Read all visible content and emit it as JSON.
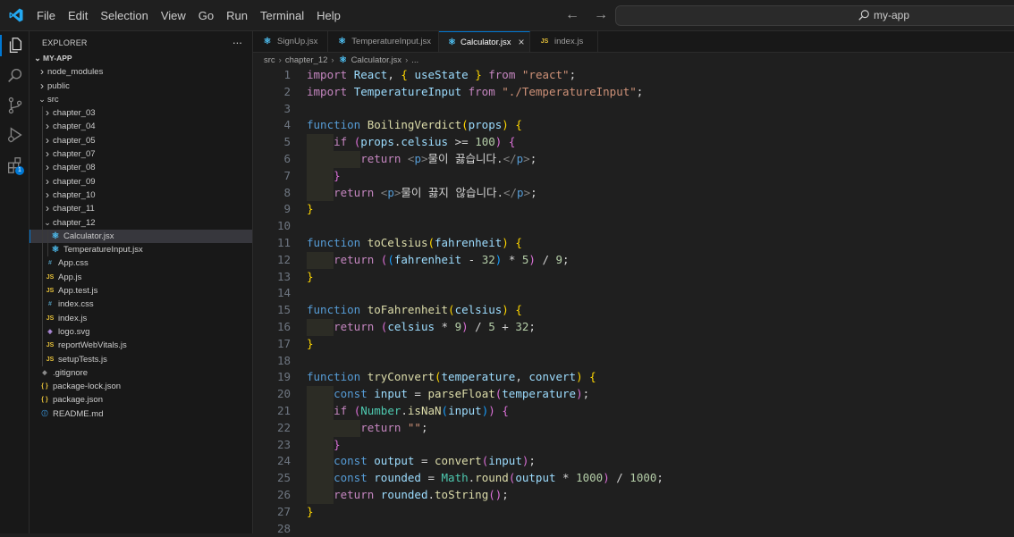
{
  "menubar": [
    "File",
    "Edit",
    "Selection",
    "View",
    "Go",
    "Run",
    "Terminal",
    "Help"
  ],
  "command_center": {
    "text": "my-app",
    "icon": "search-icon"
  },
  "activity_bar": [
    "files-icon",
    "search-icon",
    "source-control-icon",
    "run-debug-icon",
    "extensions-icon"
  ],
  "extensions_badge": "1",
  "sidebar": {
    "title": "EXPLORER",
    "more": "...",
    "root": "MY-APP",
    "items": [
      {
        "label": "node_modules",
        "kind": "folder",
        "depth": 1,
        "open": false
      },
      {
        "label": "public",
        "kind": "folder",
        "depth": 1,
        "open": false
      },
      {
        "label": "src",
        "kind": "folder",
        "depth": 1,
        "open": true
      },
      {
        "label": "chapter_03",
        "kind": "folder",
        "depth": 2,
        "open": false
      },
      {
        "label": "chapter_04",
        "kind": "folder",
        "depth": 2,
        "open": false
      },
      {
        "label": "chapter_05",
        "kind": "folder",
        "depth": 2,
        "open": false
      },
      {
        "label": "chapter_07",
        "kind": "folder",
        "depth": 2,
        "open": false
      },
      {
        "label": "chapter_08",
        "kind": "folder",
        "depth": 2,
        "open": false
      },
      {
        "label": "chapter_09",
        "kind": "folder",
        "depth": 2,
        "open": false
      },
      {
        "label": "chapter_10",
        "kind": "folder",
        "depth": 2,
        "open": false
      },
      {
        "label": "chapter_11",
        "kind": "folder",
        "depth": 2,
        "open": false
      },
      {
        "label": "chapter_12",
        "kind": "folder",
        "depth": 2,
        "open": true
      },
      {
        "label": "Calculator.jsx",
        "kind": "react",
        "depth": 3,
        "selected": true
      },
      {
        "label": "TemperatureInput.jsx",
        "kind": "react",
        "depth": 3
      },
      {
        "label": "App.css",
        "kind": "css",
        "depth": 2
      },
      {
        "label": "App.js",
        "kind": "js",
        "depth": 2
      },
      {
        "label": "App.test.js",
        "kind": "js",
        "depth": 2
      },
      {
        "label": "index.css",
        "kind": "css",
        "depth": 2
      },
      {
        "label": "index.js",
        "kind": "js",
        "depth": 2
      },
      {
        "label": "logo.svg",
        "kind": "svg",
        "depth": 2
      },
      {
        "label": "reportWebVitals.js",
        "kind": "js",
        "depth": 2
      },
      {
        "label": "setupTests.js",
        "kind": "js",
        "depth": 2
      },
      {
        "label": ".gitignore",
        "kind": "git",
        "depth": 1
      },
      {
        "label": "package-lock.json",
        "kind": "json",
        "depth": 1
      },
      {
        "label": "package.json",
        "kind": "json",
        "depth": 1
      },
      {
        "label": "README.md",
        "kind": "info",
        "depth": 1
      }
    ]
  },
  "tabs": [
    {
      "label": "SignUp.jsx",
      "kind": "react",
      "active": false
    },
    {
      "label": "TemperatureInput.jsx",
      "kind": "react",
      "active": false
    },
    {
      "label": "Calculator.jsx",
      "kind": "react",
      "active": true
    },
    {
      "label": "index.js",
      "kind": "js",
      "active": false
    }
  ],
  "breadcrumb": [
    "src",
    "chapter_12",
    "Calculator.jsx",
    "..."
  ],
  "icon_glyphs": {
    "react": "⚛",
    "js": "JS",
    "css": "#",
    "json": "{ }",
    "svg": "◈",
    "git": "◆",
    "info": "ⓘ"
  },
  "code_lines": [
    [
      [
        "kw2",
        "import "
      ],
      [
        "var",
        "React"
      ],
      [
        "txt",
        ", "
      ],
      [
        "b1",
        "{ "
      ],
      [
        "var",
        "useState"
      ],
      [
        "b1",
        " }"
      ],
      [
        "kw2",
        " from "
      ],
      [
        "str",
        "\"react\""
      ],
      [
        "txt",
        ";"
      ]
    ],
    [
      [
        "kw2",
        "import "
      ],
      [
        "var",
        "TemperatureInput"
      ],
      [
        "kw2",
        " from "
      ],
      [
        "str",
        "\"./TemperatureInput\""
      ],
      [
        "txt",
        ";"
      ]
    ],
    [],
    [
      [
        "kw",
        "function "
      ],
      [
        "fn",
        "BoilingVerdict"
      ],
      [
        "b1",
        "("
      ],
      [
        "var",
        "props"
      ],
      [
        "b1",
        ")"
      ],
      [
        "txt",
        " "
      ],
      [
        "b1",
        "{"
      ]
    ],
    [
      [
        "ind",
        "1"
      ],
      [
        "kw2",
        "if "
      ],
      [
        "b2",
        "("
      ],
      [
        "var",
        "props"
      ],
      [
        "txt",
        "."
      ],
      [
        "var",
        "celsius"
      ],
      [
        "txt",
        " >= "
      ],
      [
        "num",
        "100"
      ],
      [
        "b2",
        ")"
      ],
      [
        "txt",
        " "
      ],
      [
        "b2",
        "{"
      ]
    ],
    [
      [
        "ind",
        "2"
      ],
      [
        "kw2",
        "return "
      ],
      [
        "tag",
        "<"
      ],
      [
        "tagn",
        "p"
      ],
      [
        "tag",
        ">"
      ],
      [
        "txt",
        "물이 끓습니다."
      ],
      [
        "tag",
        "</"
      ],
      [
        "tagn",
        "p"
      ],
      [
        "tag",
        ">"
      ],
      [
        "txt",
        ";"
      ]
    ],
    [
      [
        "ind",
        "1"
      ],
      [
        "b2",
        "}"
      ]
    ],
    [
      [
        "ind",
        "1"
      ],
      [
        "kw2",
        "return "
      ],
      [
        "tag",
        "<"
      ],
      [
        "tagn",
        "p"
      ],
      [
        "tag",
        ">"
      ],
      [
        "txt",
        "물이 끓지 않습니다."
      ],
      [
        "tag",
        "</"
      ],
      [
        "tagn",
        "p"
      ],
      [
        "tag",
        ">"
      ],
      [
        "txt",
        ";"
      ]
    ],
    [
      [
        "b1",
        "}"
      ]
    ],
    [],
    [
      [
        "kw",
        "function "
      ],
      [
        "fn",
        "toCelsius"
      ],
      [
        "b1",
        "("
      ],
      [
        "var",
        "fahrenheit"
      ],
      [
        "b1",
        ")"
      ],
      [
        "txt",
        " "
      ],
      [
        "b1",
        "{"
      ]
    ],
    [
      [
        "ind",
        "1"
      ],
      [
        "kw2",
        "return "
      ],
      [
        "b2",
        "("
      ],
      [
        "b3",
        "("
      ],
      [
        "var",
        "fahrenheit"
      ],
      [
        "txt",
        " - "
      ],
      [
        "num",
        "32"
      ],
      [
        "b3",
        ")"
      ],
      [
        "txt",
        " * "
      ],
      [
        "num",
        "5"
      ],
      [
        "b2",
        ")"
      ],
      [
        "txt",
        " / "
      ],
      [
        "num",
        "9"
      ],
      [
        "txt",
        ";"
      ]
    ],
    [
      [
        "b1",
        "}"
      ]
    ],
    [],
    [
      [
        "kw",
        "function "
      ],
      [
        "fn",
        "toFahrenheit"
      ],
      [
        "b1",
        "("
      ],
      [
        "var",
        "celsius"
      ],
      [
        "b1",
        ")"
      ],
      [
        "txt",
        " "
      ],
      [
        "b1",
        "{"
      ]
    ],
    [
      [
        "ind",
        "1"
      ],
      [
        "kw2",
        "return "
      ],
      [
        "b2",
        "("
      ],
      [
        "var",
        "celsius"
      ],
      [
        "txt",
        " * "
      ],
      [
        "num",
        "9"
      ],
      [
        "b2",
        ")"
      ],
      [
        "txt",
        " / "
      ],
      [
        "num",
        "5"
      ],
      [
        "txt",
        " + "
      ],
      [
        "num",
        "32"
      ],
      [
        "txt",
        ";"
      ]
    ],
    [
      [
        "b1",
        "}"
      ]
    ],
    [],
    [
      [
        "kw",
        "function "
      ],
      [
        "fn",
        "tryConvert"
      ],
      [
        "b1",
        "("
      ],
      [
        "var",
        "temperature"
      ],
      [
        "txt",
        ", "
      ],
      [
        "var",
        "convert"
      ],
      [
        "b1",
        ")"
      ],
      [
        "txt",
        " "
      ],
      [
        "b1",
        "{"
      ]
    ],
    [
      [
        "ind",
        "1"
      ],
      [
        "kw",
        "const "
      ],
      [
        "var",
        "input"
      ],
      [
        "txt",
        " = "
      ],
      [
        "fn",
        "parseFloat"
      ],
      [
        "b2",
        "("
      ],
      [
        "var",
        "temperature"
      ],
      [
        "b2",
        ")"
      ],
      [
        "txt",
        ";"
      ]
    ],
    [
      [
        "ind",
        "1"
      ],
      [
        "kw2",
        "if "
      ],
      [
        "b2",
        "("
      ],
      [
        "cls",
        "Number"
      ],
      [
        "txt",
        "."
      ],
      [
        "fn",
        "isNaN"
      ],
      [
        "b3",
        "("
      ],
      [
        "var",
        "input"
      ],
      [
        "b3",
        ")"
      ],
      [
        "b2",
        ")"
      ],
      [
        "txt",
        " "
      ],
      [
        "b2",
        "{"
      ]
    ],
    [
      [
        "ind",
        "2"
      ],
      [
        "kw2",
        "return "
      ],
      [
        "str",
        "\"\""
      ],
      [
        "txt",
        ";"
      ]
    ],
    [
      [
        "ind",
        "1"
      ],
      [
        "b2",
        "}"
      ]
    ],
    [
      [
        "ind",
        "1"
      ],
      [
        "kw",
        "const "
      ],
      [
        "var",
        "output"
      ],
      [
        "txt",
        " = "
      ],
      [
        "fn",
        "convert"
      ],
      [
        "b2",
        "("
      ],
      [
        "var",
        "input"
      ],
      [
        "b2",
        ")"
      ],
      [
        "txt",
        ";"
      ]
    ],
    [
      [
        "ind",
        "1"
      ],
      [
        "kw",
        "const "
      ],
      [
        "var",
        "rounded"
      ],
      [
        "txt",
        " = "
      ],
      [
        "cls",
        "Math"
      ],
      [
        "txt",
        "."
      ],
      [
        "fn",
        "round"
      ],
      [
        "b2",
        "("
      ],
      [
        "var",
        "output"
      ],
      [
        "txt",
        " * "
      ],
      [
        "num",
        "1000"
      ],
      [
        "b2",
        ")"
      ],
      [
        "txt",
        " / "
      ],
      [
        "num",
        "1000"
      ],
      [
        "txt",
        ";"
      ]
    ],
    [
      [
        "ind",
        "1"
      ],
      [
        "kw2",
        "return "
      ],
      [
        "var",
        "rounded"
      ],
      [
        "txt",
        "."
      ],
      [
        "fn",
        "toString"
      ],
      [
        "b2",
        "()"
      ],
      [
        "txt",
        ";"
      ]
    ],
    [
      [
        "b1",
        "}"
      ]
    ],
    []
  ]
}
